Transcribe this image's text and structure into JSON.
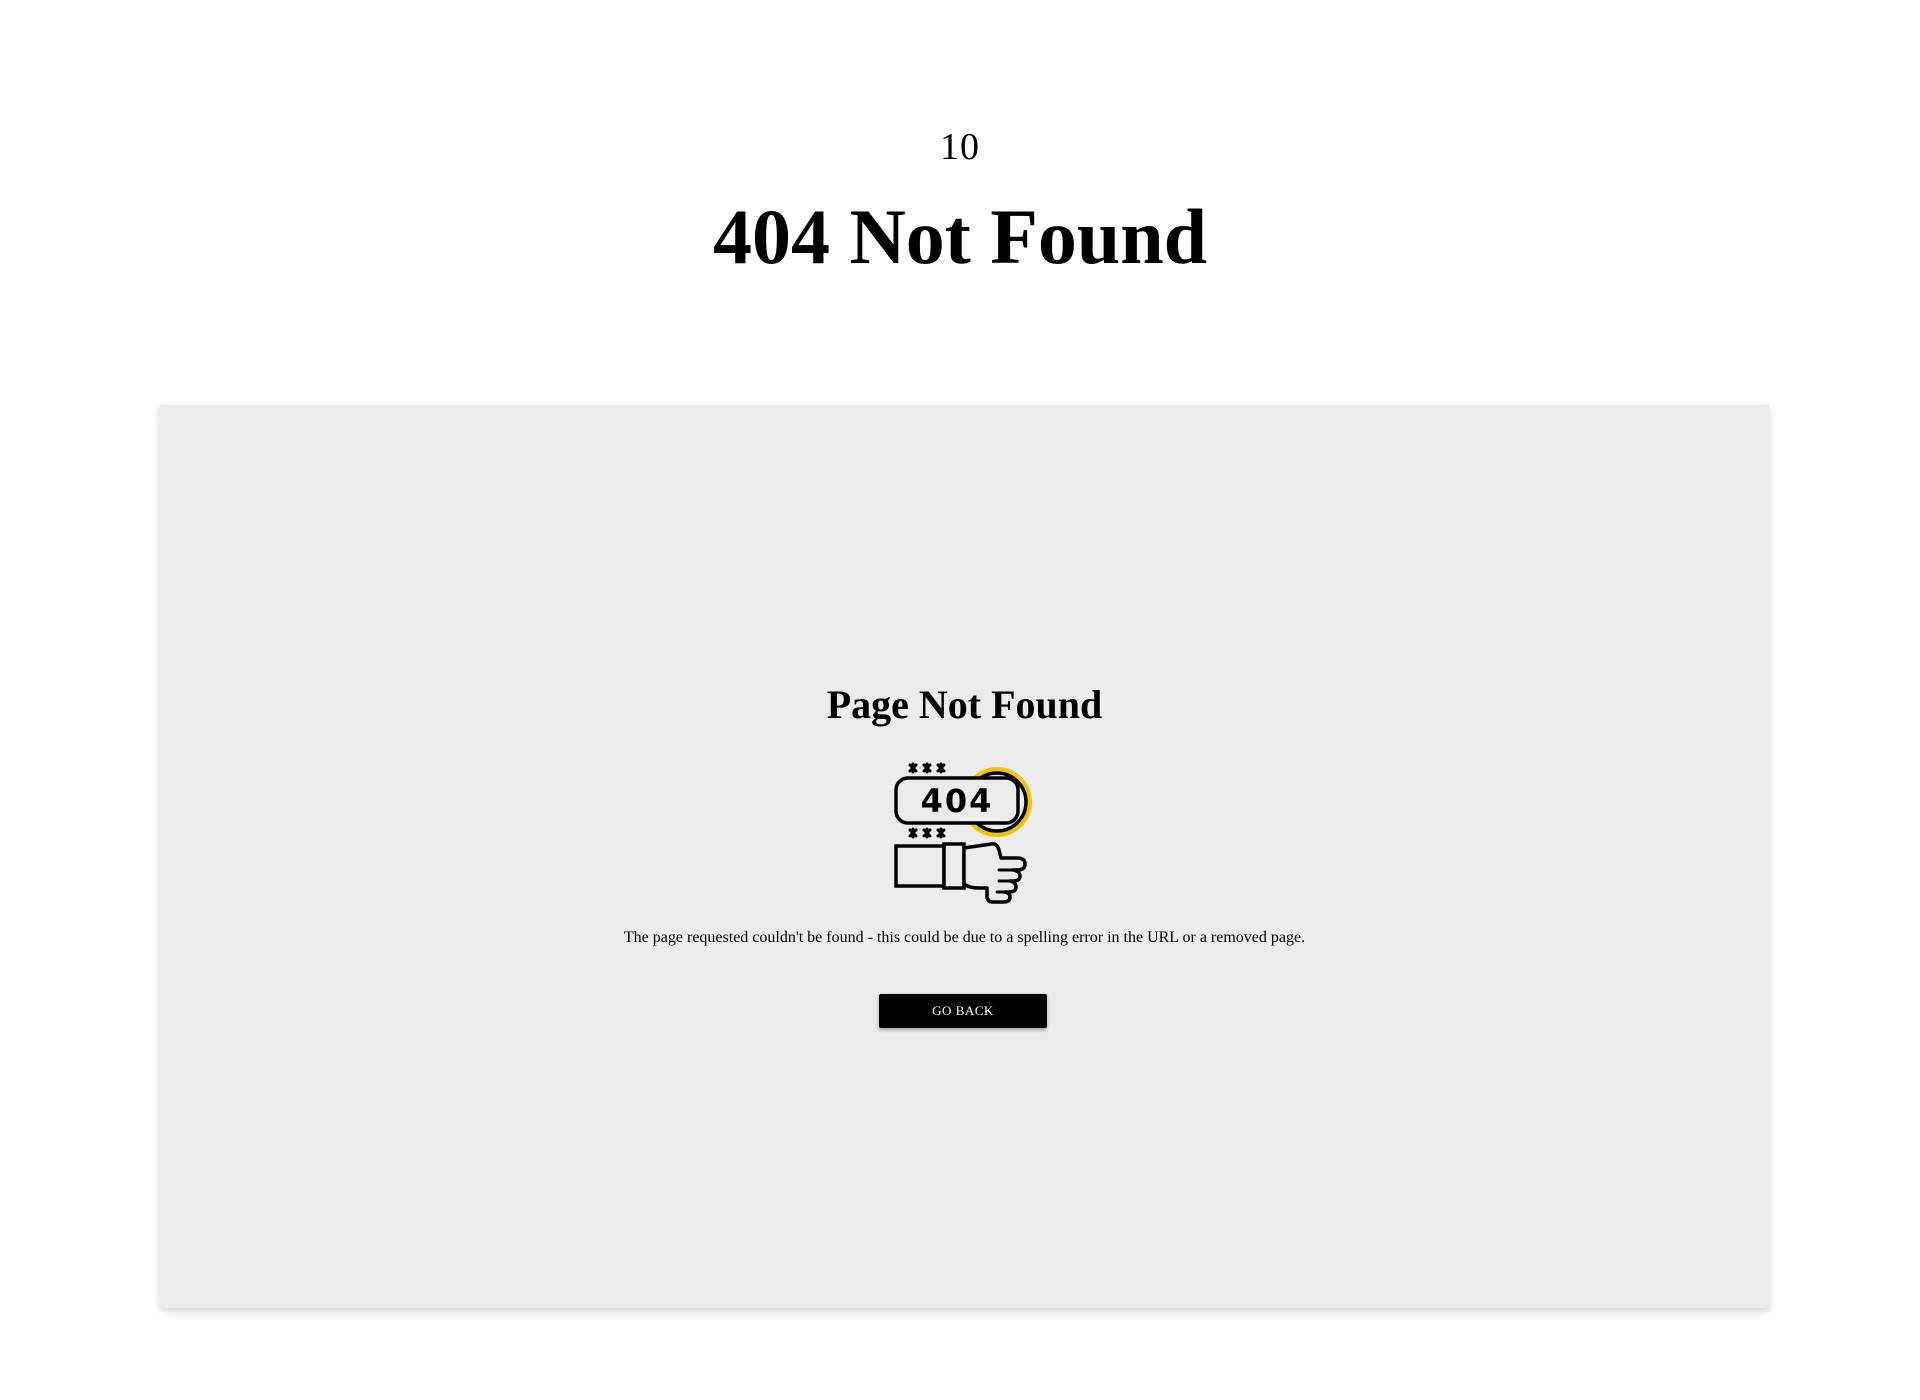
{
  "header": {
    "page_number": "10",
    "title": "404 Not Found"
  },
  "card": {
    "title": "Page Not Found",
    "illustration": {
      "icon": "404-error-pointing-hand-icon",
      "code_text": "404",
      "accent_color": "#f5c400"
    },
    "message": "The page requested couldn't be found - this could be due to a spelling error in the URL or a removed page.",
    "button_label": "GO BACK"
  },
  "colors": {
    "background": "#ffffff",
    "card_background": "#ebebeb",
    "button_background": "#000000",
    "button_text": "#ffffff",
    "accent": "#f5c400"
  }
}
